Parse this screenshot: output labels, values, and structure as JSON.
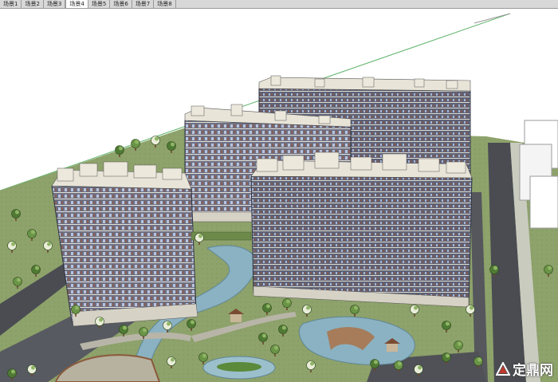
{
  "scene_tabs": [
    "场景1",
    "场景2",
    "场景3",
    "场景4",
    "场景5",
    "场景6",
    "场景7",
    "场景8"
  ],
  "active_tab": "场景4",
  "watermark": {
    "text": "定鼎网",
    "logo_icon": "dingding-logo-icon"
  },
  "colors": {
    "sky": "#ffffff",
    "lawn": "#8da06a",
    "road": "#4a4c52",
    "water": "#8bb2c2",
    "facade": "#6a6f82",
    "roof": "#e8e4d8",
    "tree": "#5d8a3c",
    "tab_bar": "#d8d8d8"
  }
}
